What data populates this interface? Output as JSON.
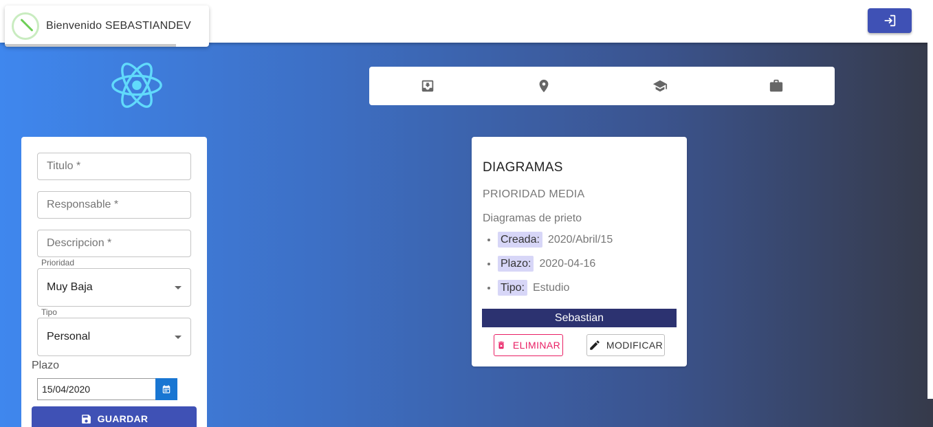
{
  "header": {
    "welcome_text": "Bienvenido SEBASTIANDEV"
  },
  "tabs": [
    {
      "icon": "inbox-icon"
    },
    {
      "icon": "location-pin-icon"
    },
    {
      "icon": "graduation-cap-icon"
    },
    {
      "icon": "briefcase-icon"
    }
  ],
  "form": {
    "titulo_placeholder": "Titulo *",
    "responsable_placeholder": "Responsable *",
    "descripcion_placeholder": "Descripcion *",
    "prioridad_label": "Prioridad",
    "prioridad_value": "Muy Baja",
    "tipo_label": "Tipo",
    "tipo_value": "Personal",
    "plazo_label": "Plazo",
    "plazo_value": "15/04/2020",
    "save_label": "GUARDAR"
  },
  "task": {
    "title": "DIAGRAMAS",
    "priority": "PRIORIDAD MEDIA",
    "description": "Diagramas de prieto",
    "details": [
      {
        "label": "Creada:",
        "value": "2020/Abril/15"
      },
      {
        "label": "Plazo:",
        "value": "2020-04-16"
      },
      {
        "label": "Tipo:",
        "value": "Estudio"
      }
    ],
    "owner": "Sebastian",
    "delete_label": "ELIMINAR",
    "modify_label": "MODIFICAR"
  },
  "colors": {
    "primary": "#3f51b5",
    "owner_bar": "#2c3270",
    "delete": "#e91e63",
    "tag_bg": "#d7d6f7",
    "react": "#61dafb"
  }
}
